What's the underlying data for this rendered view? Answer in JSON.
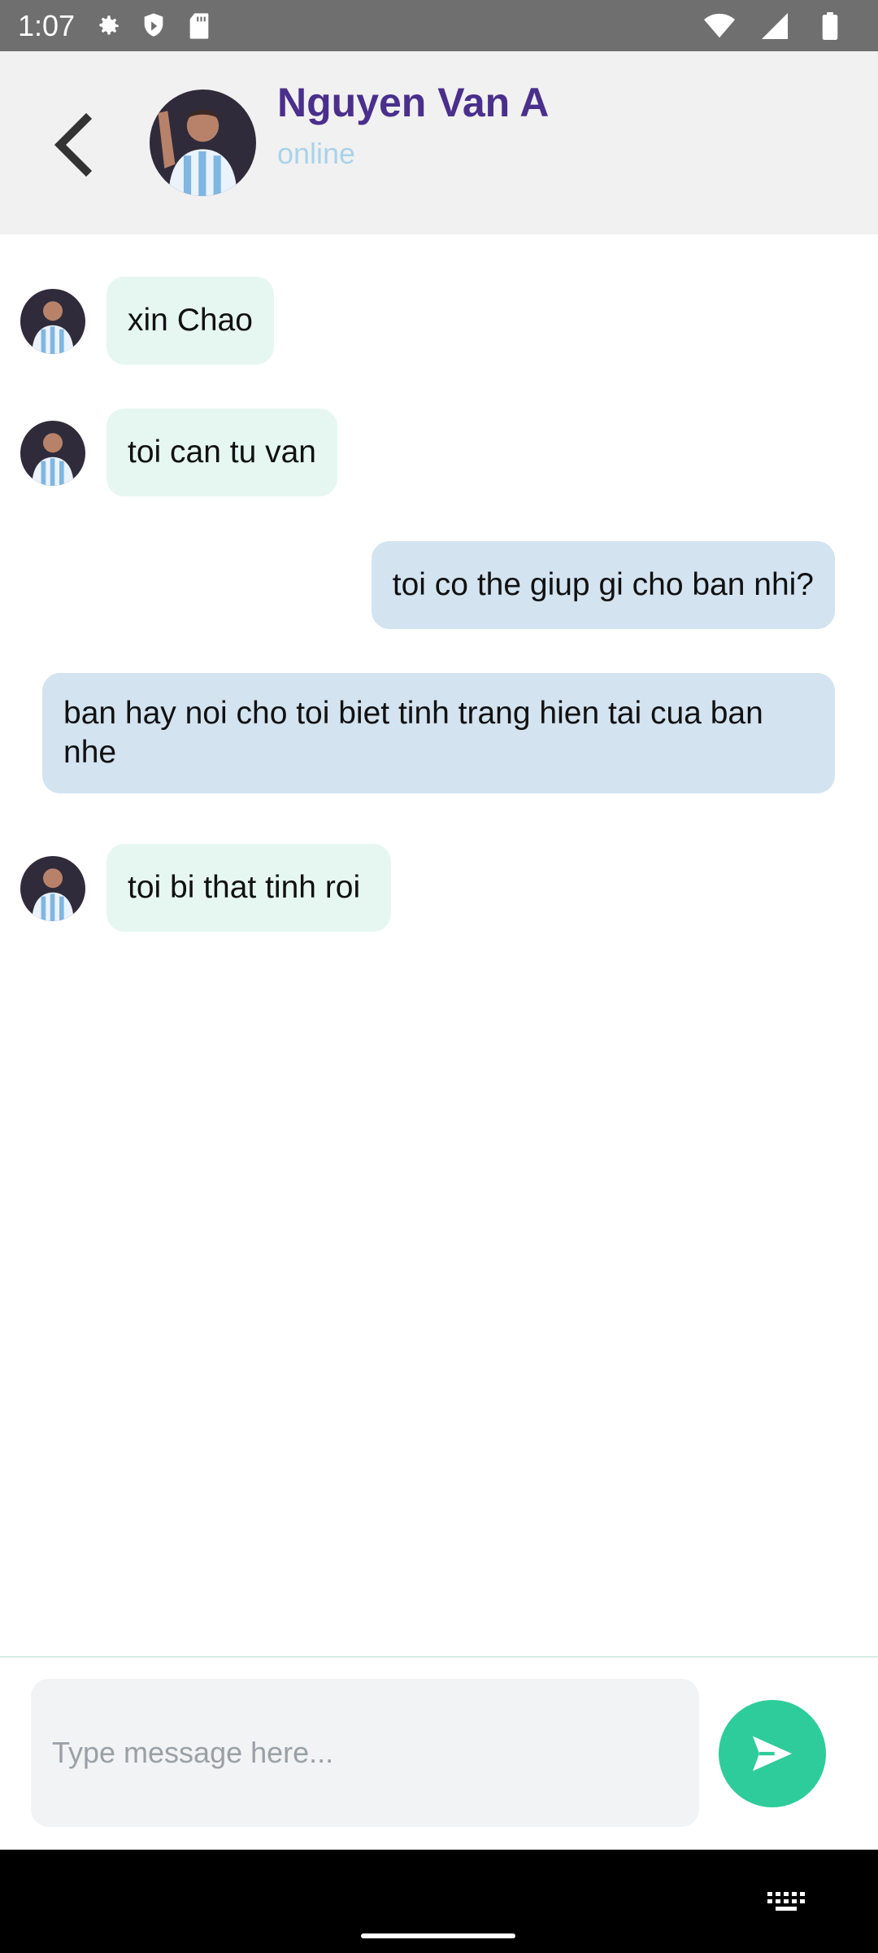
{
  "status_bar": {
    "time": "1:07",
    "icons": [
      "gear-icon",
      "shield-icon",
      "sd-card-icon",
      "wifi-icon",
      "signal-icon",
      "battery-icon"
    ]
  },
  "header": {
    "back_icon": "chevron-left-icon",
    "contact_name": "Nguyen Van A",
    "contact_status": "online"
  },
  "messages": [
    {
      "direction": "in",
      "text": "xin Chao",
      "has_avatar": true
    },
    {
      "direction": "in",
      "text": "toi can tu van",
      "has_avatar": true
    },
    {
      "direction": "out",
      "text": "toi co the giup gi cho ban nhi?",
      "has_avatar": false
    },
    {
      "direction": "out",
      "text": "ban hay noi cho toi biet tinh trang hien tai cua ban nhe",
      "has_avatar": false
    },
    {
      "direction": "in",
      "text": "toi bi that tinh roi",
      "has_avatar": true
    }
  ],
  "composer": {
    "value": "",
    "placeholder": "Type message here...",
    "send_icon": "send-icon"
  },
  "colors": {
    "accent": "#2ecc9a",
    "name": "#4a2f8c",
    "status": "#a9d3ea",
    "incoming_bubble": "#e6f7f2",
    "outgoing_bubble": "#d3e3f0"
  }
}
